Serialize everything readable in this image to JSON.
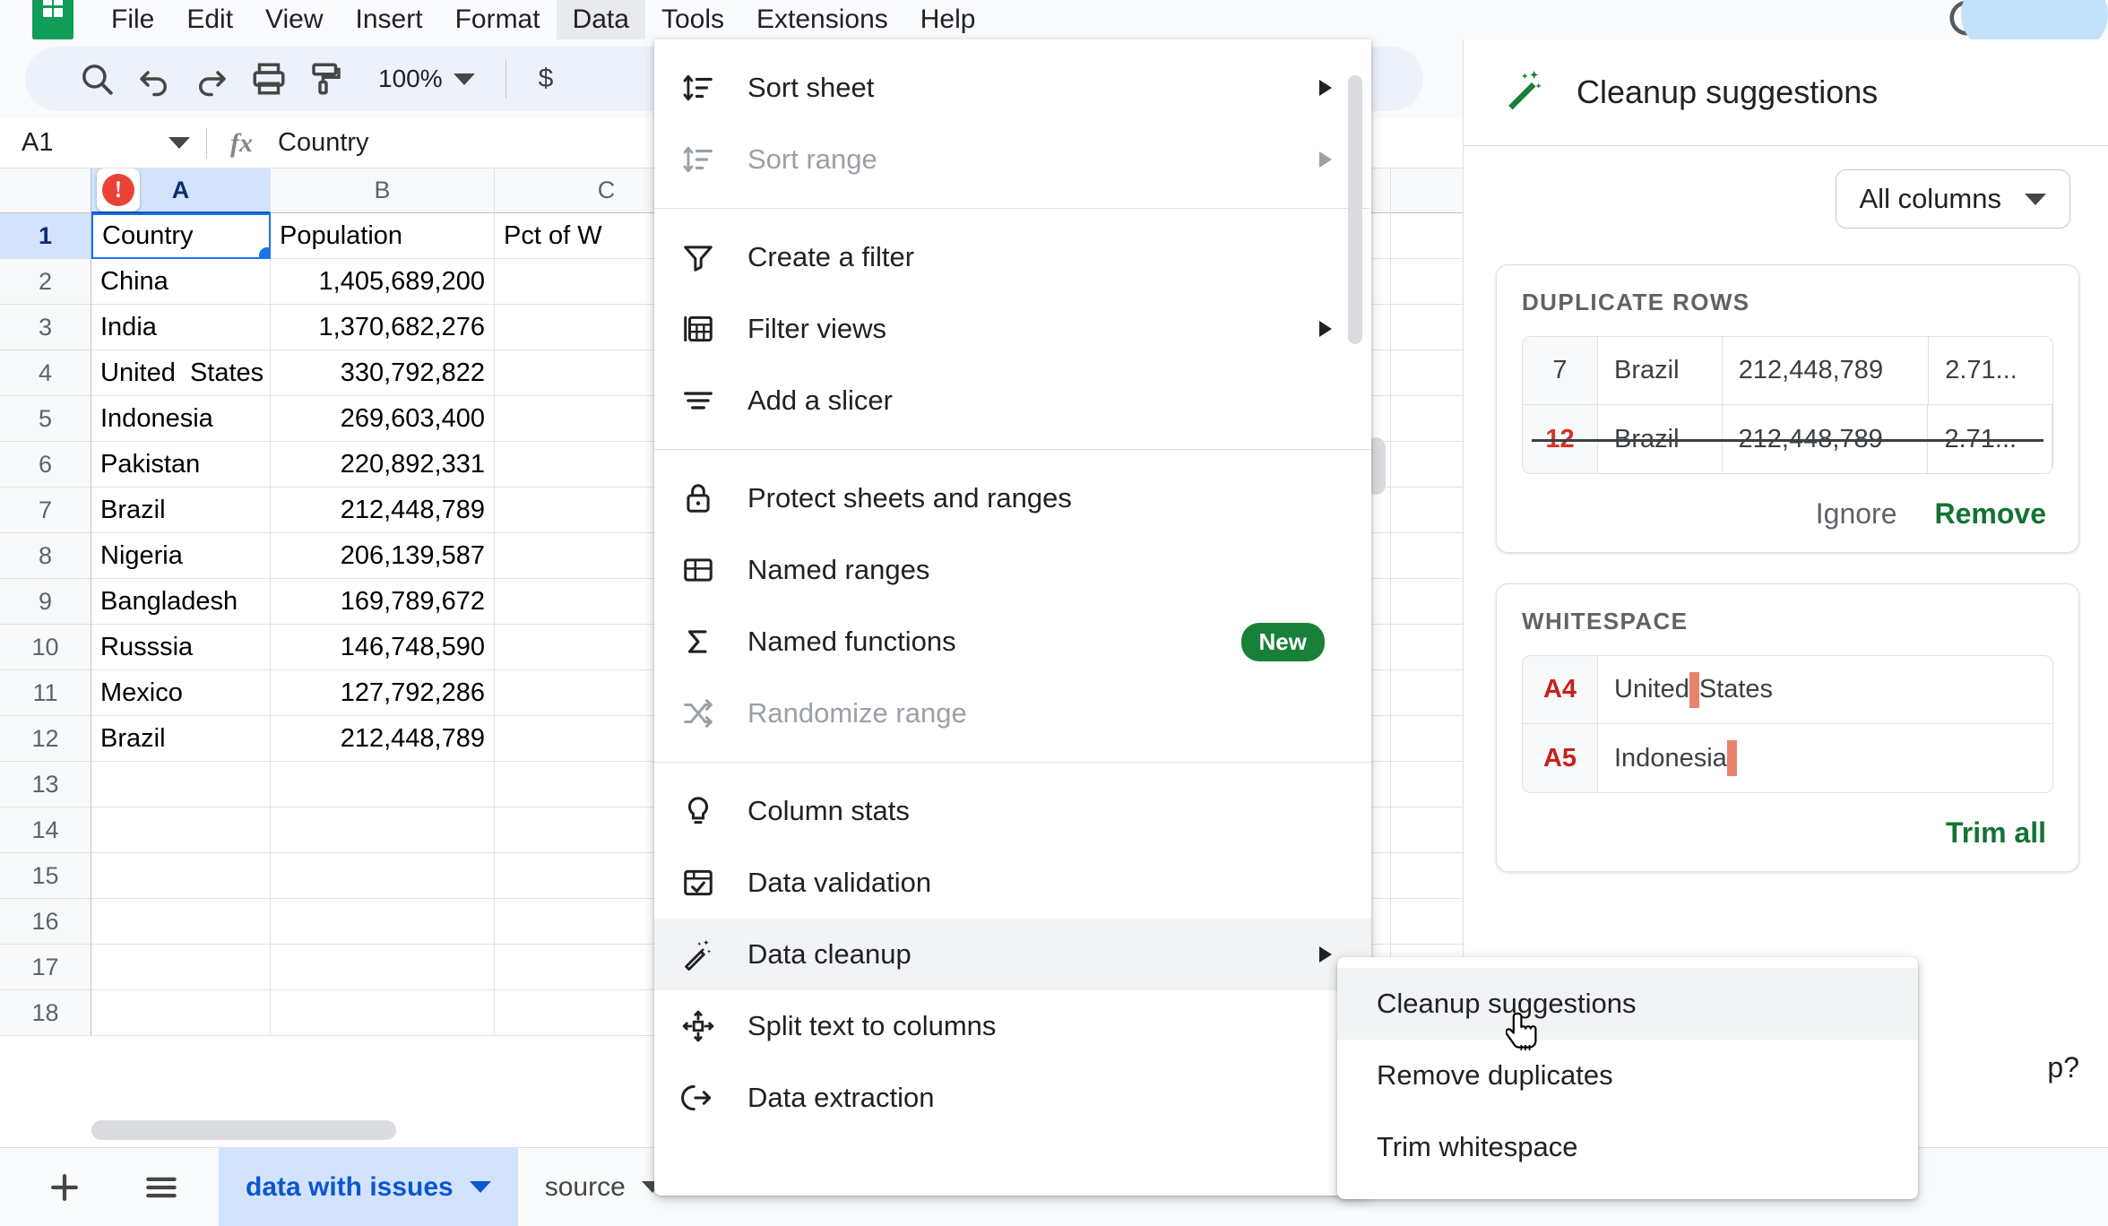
{
  "menubar": {
    "logo_name": "google-sheets-logo",
    "items": [
      {
        "label": "File"
      },
      {
        "label": "Edit"
      },
      {
        "label": "View"
      },
      {
        "label": "Insert"
      },
      {
        "label": "Format"
      },
      {
        "label": "Data"
      },
      {
        "label": "Tools"
      },
      {
        "label": "Extensions"
      },
      {
        "label": "Help"
      }
    ],
    "active": "Data"
  },
  "toolbar": {
    "zoom": "100%",
    "currency": "$",
    "icons": [
      "search-icon",
      "undo-icon",
      "redo-icon",
      "print-icon",
      "paint-format-icon"
    ]
  },
  "formulabar": {
    "namebox": "A1",
    "fx": "fx",
    "value": "Country"
  },
  "grid": {
    "columns": [
      "A",
      "B",
      "C"
    ],
    "selected_column": "A",
    "rows": [
      {
        "n": "1",
        "a": "Country",
        "b": "Population",
        "c": "Pct of W"
      },
      {
        "n": "2",
        "a": "China",
        "b": "1,405,689,200",
        "c": ""
      },
      {
        "n": "3",
        "a": "India",
        "b": "1,370,682,276",
        "c": ""
      },
      {
        "n": "4",
        "a": "United  States",
        "b": "330,792,822",
        "c": ""
      },
      {
        "n": "5",
        "a": "Indonesia",
        "b": "269,603,400",
        "c": ""
      },
      {
        "n": "6",
        "a": "Pakistan",
        "b": "220,892,331",
        "c": ""
      },
      {
        "n": "7",
        "a": "Brazil",
        "b": "212,448,789",
        "c": ""
      },
      {
        "n": "8",
        "a": "Nigeria",
        "b": "206,139,587",
        "c": ""
      },
      {
        "n": "9",
        "a": "Bangladesh",
        "b": "169,789,672",
        "c": ""
      },
      {
        "n": "10",
        "a": "Russsia",
        "b": "146,748,590",
        "c": ""
      },
      {
        "n": "11",
        "a": "Mexico",
        "b": "127,792,286",
        "c": ""
      },
      {
        "n": "12",
        "a": "Brazil",
        "b": "212,448,789",
        "c": ""
      },
      {
        "n": "13",
        "a": "",
        "b": "",
        "c": ""
      },
      {
        "n": "14",
        "a": "",
        "b": "",
        "c": ""
      },
      {
        "n": "15",
        "a": "",
        "b": "",
        "c": ""
      },
      {
        "n": "16",
        "a": "",
        "b": "",
        "c": ""
      },
      {
        "n": "17",
        "a": "",
        "b": "",
        "c": ""
      },
      {
        "n": "18",
        "a": "",
        "b": "",
        "c": ""
      }
    ]
  },
  "sheettabs": {
    "add_label": "+",
    "all_sheets_label": "all-sheets-icon",
    "tabs": [
      {
        "label": "data with issues",
        "active": true
      },
      {
        "label": "source",
        "active": false
      }
    ]
  },
  "data_menu": {
    "items": [
      {
        "label": "Sort sheet",
        "icon": "sort-icon",
        "submenu": true,
        "disabled": false,
        "badge": ""
      },
      {
        "label": "Sort range",
        "icon": "sort-icon",
        "submenu": true,
        "disabled": true,
        "badge": ""
      },
      {
        "sep": true
      },
      {
        "label": "Create a filter",
        "icon": "funnel-icon",
        "submenu": false,
        "disabled": false,
        "badge": ""
      },
      {
        "label": "Filter views",
        "icon": "filter-views-icon",
        "submenu": true,
        "disabled": false,
        "badge": ""
      },
      {
        "label": "Add a slicer",
        "icon": "slicer-icon",
        "submenu": false,
        "disabled": false,
        "badge": ""
      },
      {
        "sep": true
      },
      {
        "label": "Protect sheets and ranges",
        "icon": "lock-icon",
        "submenu": false,
        "disabled": false,
        "badge": ""
      },
      {
        "label": "Named ranges",
        "icon": "named-ranges-icon",
        "submenu": false,
        "disabled": false,
        "badge": ""
      },
      {
        "label": "Named functions",
        "icon": "sigma-icon",
        "submenu": false,
        "disabled": false,
        "badge": "New"
      },
      {
        "label": "Randomize range",
        "icon": "shuffle-icon",
        "submenu": false,
        "disabled": true,
        "badge": ""
      },
      {
        "sep": true
      },
      {
        "label": "Column stats",
        "icon": "lightbulb-icon",
        "submenu": false,
        "disabled": false,
        "badge": ""
      },
      {
        "label": "Data validation",
        "icon": "validation-icon",
        "submenu": false,
        "disabled": false,
        "badge": ""
      },
      {
        "label": "Data cleanup",
        "icon": "magic-wand-icon",
        "submenu": true,
        "disabled": false,
        "badge": "",
        "highlighted": true
      },
      {
        "label": "Split text to columns",
        "icon": "split-icon",
        "submenu": false,
        "disabled": false,
        "badge": ""
      },
      {
        "label": "Data extraction",
        "icon": "extract-icon",
        "submenu": false,
        "disabled": false,
        "badge": ""
      }
    ]
  },
  "data_cleanup_submenu": {
    "items": [
      {
        "label": "Cleanup suggestions",
        "highlighted": true
      },
      {
        "label": "Remove duplicates",
        "highlighted": false
      },
      {
        "label": "Trim whitespace",
        "highlighted": false
      }
    ]
  },
  "sidepanel": {
    "icon": "magic-wand-icon",
    "title": "Cleanup suggestions",
    "filter": {
      "label": "All columns"
    },
    "cards": [
      {
        "title": "DUPLICATE ROWS",
        "type": "duplicate",
        "rows": [
          {
            "index": "7",
            "cells": [
              "Brazil",
              "212,448,789",
              "2.71..."
            ],
            "struck": false
          },
          {
            "index": "12",
            "cells": [
              "Brazil",
              "212,448,789",
              "2.71..."
            ],
            "struck": true
          }
        ],
        "actions": {
          "secondary": "Ignore",
          "primary": "Remove"
        }
      },
      {
        "title": "WHITESPACE",
        "type": "whitespace",
        "rows": [
          {
            "index": "A4",
            "before": "United ",
            "after": "States"
          },
          {
            "index": "A5",
            "before": "Indonesia",
            "after": ""
          }
        ],
        "actions": {
          "primary": "Trim all"
        }
      }
    ],
    "footer_question": "p?"
  },
  "colors": {
    "sheets_green": "#0f9d58",
    "accent_blue": "#1a73e8",
    "error_red": "#ea4335",
    "badge_green": "#188038",
    "action_green": "#137333",
    "whitespace_marker": "#e8836f"
  }
}
